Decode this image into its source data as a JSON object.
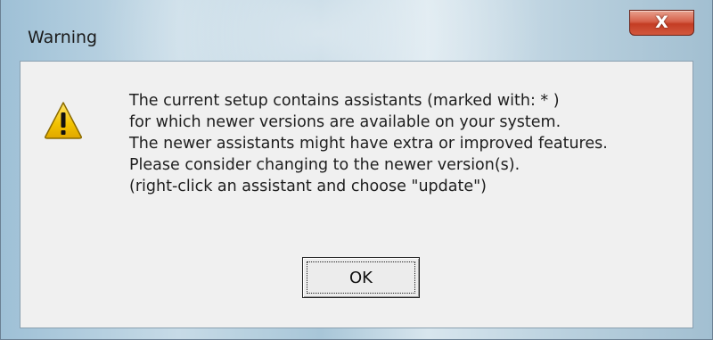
{
  "window": {
    "title": "Warning",
    "close_glyph": "X"
  },
  "message": {
    "lines": [
      "The current setup contains assistants (marked with: * )",
      "for which newer versions are available on your system.",
      "The newer assistants might have extra or improved features.",
      "Please consider changing to the newer version(s).",
      "(right-click an assistant and choose \"update\")"
    ]
  },
  "buttons": {
    "ok_label": "OK"
  },
  "icons": {
    "message_icon": "warning-icon",
    "close_icon": "close-icon"
  },
  "colors": {
    "close_button": "#c43d24",
    "warning_yellow": "#f2c200",
    "client_background": "#f0f0f0"
  }
}
